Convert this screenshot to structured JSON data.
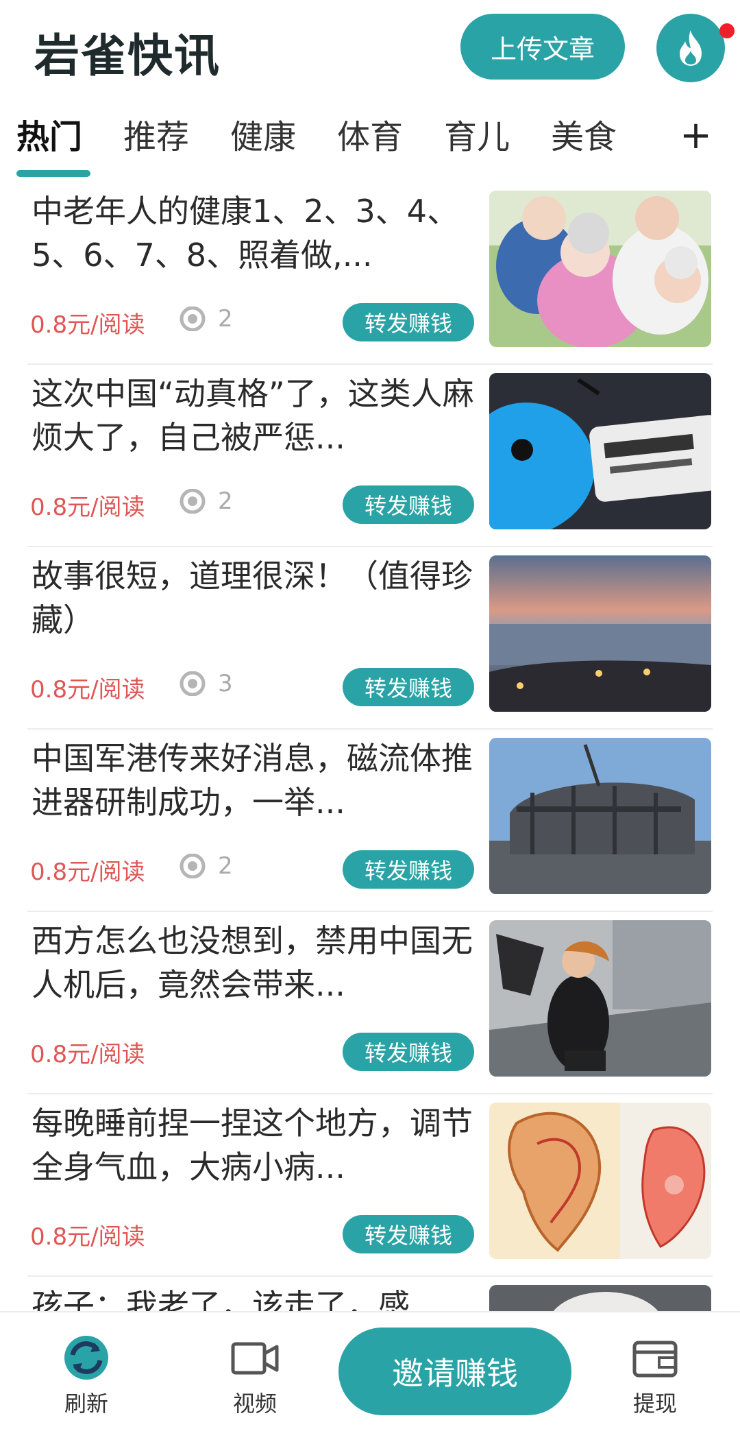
{
  "header": {
    "app_title": "岩雀快讯",
    "upload_label": "上传文章",
    "fire_icon": "fire-icon",
    "has_notification": true
  },
  "tabs": {
    "items": [
      "热门",
      "推荐",
      "健康",
      "体育",
      "育儿",
      "美食"
    ],
    "active_index": 0,
    "add_label": "+"
  },
  "feed": {
    "items": [
      {
        "title": "中老年人的健康1、2、3、4、5、6、7、8、照着做,...",
        "price": "0.8元/阅读",
        "views": "2",
        "share_label": "转发赚钱",
        "thumb": "elderly-group-photo"
      },
      {
        "title": "这次中国“动真格”了，这类人麻烦大了，自己被严惩...",
        "price": "0.8元/阅读",
        "views": "2",
        "share_label": "转发赚钱",
        "thumb": "ant-financial-photo"
      },
      {
        "title": "故事很短，道理很深！（值得珍藏）",
        "price": "0.8元/阅读",
        "views": "3",
        "share_label": "转发赚钱",
        "thumb": "beach-sunset-photo"
      },
      {
        "title": "中国军港传来好消息，磁流体推进器研制成功，一举...",
        "price": "0.8元/阅读",
        "views": "2",
        "share_label": "转发赚钱",
        "thumb": "submarine-shipyard-photo"
      },
      {
        "title": "西方怎么也没想到，禁用中国无人机后，竟然会带来...",
        "price": "0.8元/阅读",
        "views": "",
        "share_label": "转发赚钱",
        "thumb": "windy-street-photo"
      },
      {
        "title": "每晚睡前捏一捏这个地方，调节全身气血，大病小病...",
        "price": "0.8元/阅读",
        "views": "",
        "share_label": "转发赚钱",
        "thumb": "ear-acupuncture-chart"
      },
      {
        "title": "孩子：我老了，该走了，感",
        "price": "",
        "views": "",
        "share_label": "",
        "thumb": "elderly-portrait-photo"
      }
    ]
  },
  "bottom_nav": {
    "refresh_label": "刷新",
    "video_label": "视频",
    "invite_label": "邀请赚钱",
    "withdraw_label": "提现"
  },
  "colors": {
    "accent": "#2aa3a6",
    "price": "#e05555",
    "notification": "#f0202a"
  }
}
